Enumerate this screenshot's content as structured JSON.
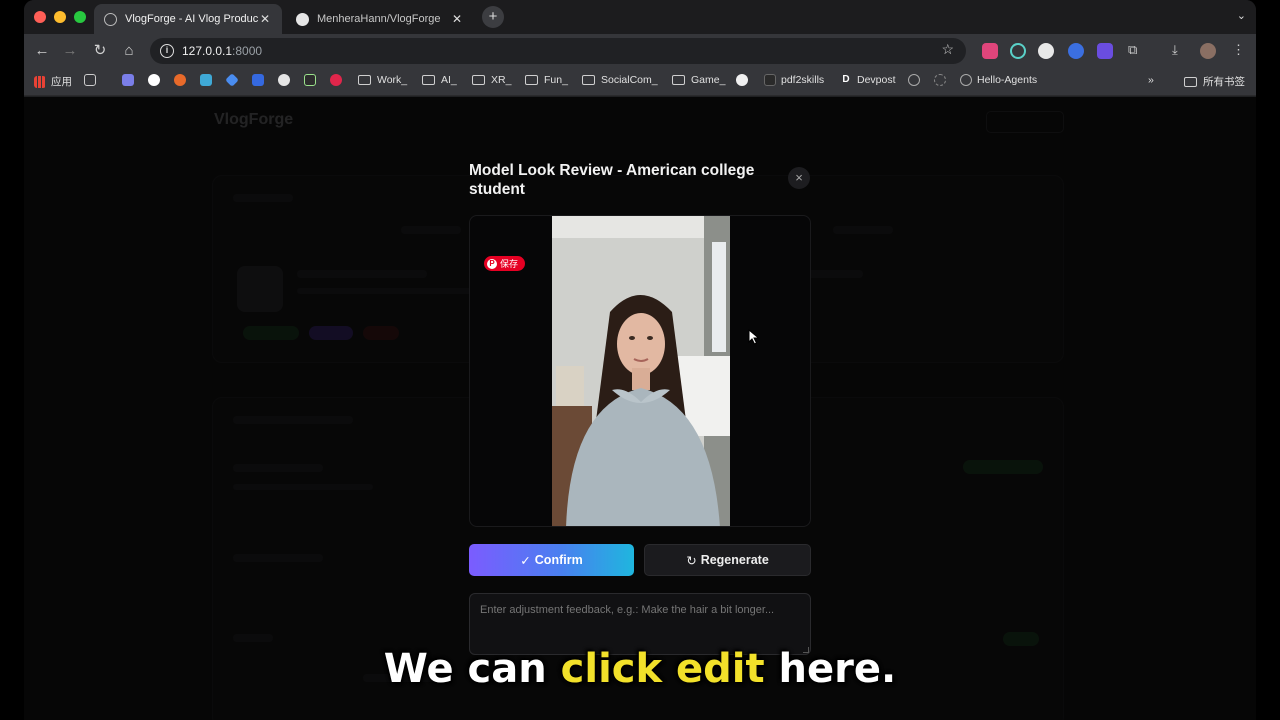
{
  "browser": {
    "tabs": [
      {
        "title": "VlogForge - AI Vlog Product V",
        "active": true
      },
      {
        "title": "MenheraHann/VlogForge",
        "active": false
      }
    ],
    "address": {
      "host": "127.0.0.1",
      "port": ":8000"
    },
    "bookmarks": [
      {
        "label": "应用",
        "type": "apps"
      },
      {
        "label": "Work_",
        "type": "folder"
      },
      {
        "label": "AI_",
        "type": "folder"
      },
      {
        "label": "XR_",
        "type": "folder"
      },
      {
        "label": "Fun_",
        "type": "folder"
      },
      {
        "label": "SocialCom_",
        "type": "folder"
      },
      {
        "label": "Game_",
        "type": "folder"
      },
      {
        "label": "pdf2skills",
        "type": "site"
      },
      {
        "label": "Devpost",
        "type": "site"
      },
      {
        "label": "Hello-Agents",
        "type": "site"
      },
      {
        "label": "所有书签",
        "type": "folder"
      }
    ]
  },
  "background_app": {
    "logo": "VlogForge"
  },
  "modal": {
    "title": "Model Look Review - American college student",
    "close_label": "×",
    "image": {
      "pin_save_label": "保存"
    },
    "confirm_label": "Confirm",
    "regenerate_label": "Regenerate",
    "feedback_placeholder": "Enter adjustment feedback, e.g.: Make the hair a bit longer..."
  },
  "caption": {
    "prefix": "We can ",
    "highlight": "click edit",
    "suffix": " here."
  },
  "colors": {
    "confirm_gradient_start": "#7b5cff",
    "confirm_gradient_end": "#1fb6de",
    "caption_highlight": "#f2e12a"
  }
}
